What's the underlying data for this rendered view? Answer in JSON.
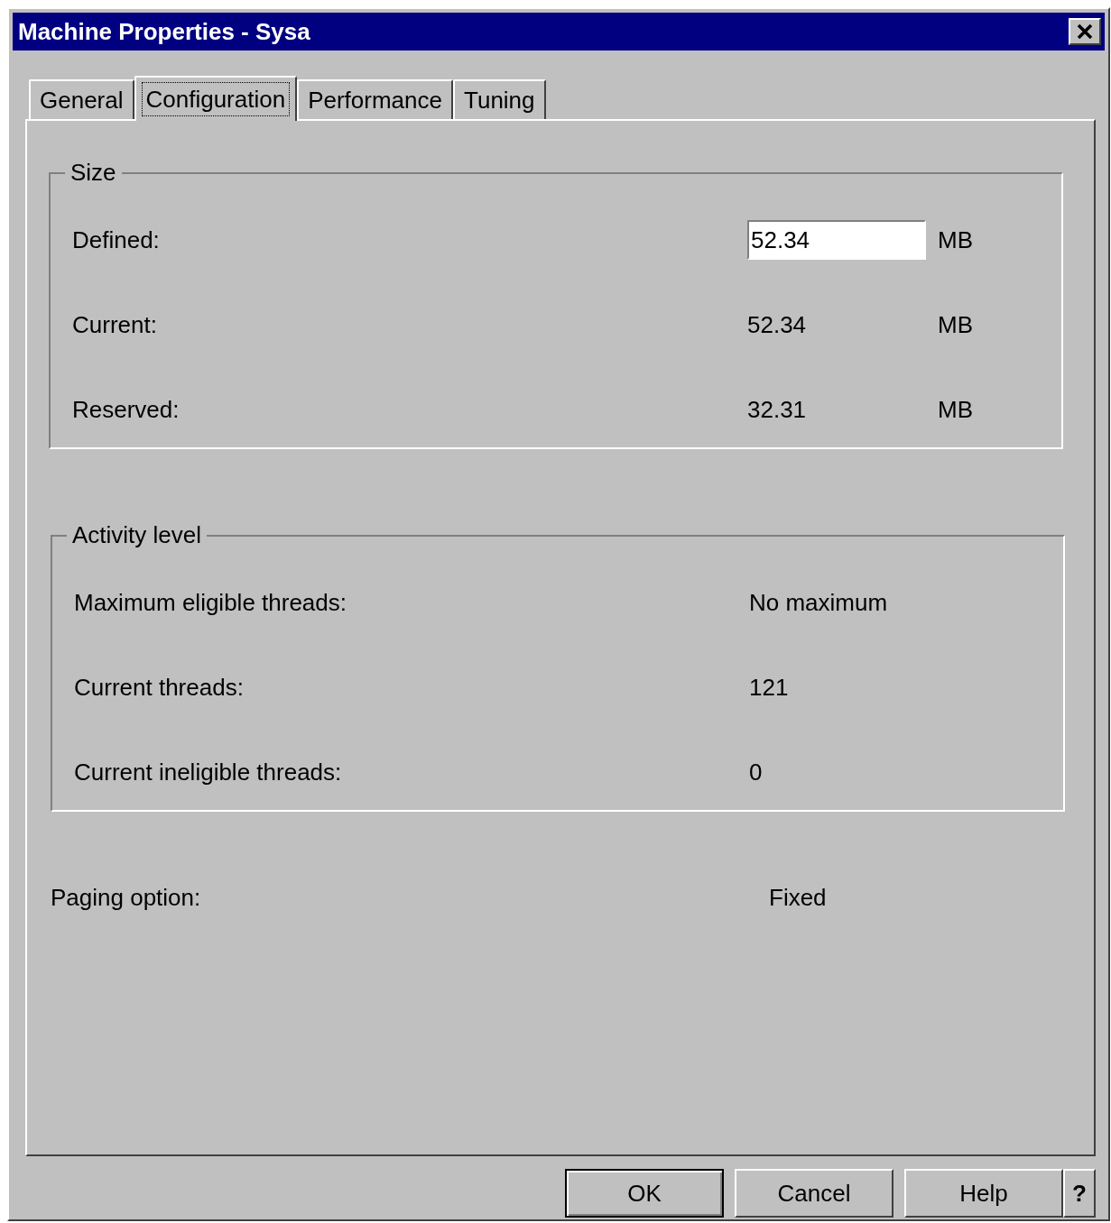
{
  "window": {
    "title": "Machine Properties - Sysa"
  },
  "tabs": [
    {
      "label": "General",
      "selected": false
    },
    {
      "label": "Configuration",
      "selected": true
    },
    {
      "label": "Performance",
      "selected": false
    },
    {
      "label": "Tuning",
      "selected": false
    }
  ],
  "groups": [
    {
      "title": "Size",
      "rows": [
        {
          "label": "Defined:",
          "kind": "field",
          "value": "52.34",
          "unit": "MB"
        },
        {
          "label": "Current:",
          "kind": "text",
          "value": "52.34",
          "unit": "MB"
        },
        {
          "label": "Reserved:",
          "kind": "text",
          "value": "32.31",
          "unit": "MB"
        }
      ]
    },
    {
      "title": "Activity level",
      "rows": [
        {
          "label": "Maximum eligible threads:",
          "kind": "text",
          "value": "No maximum"
        },
        {
          "label": "Current threads:",
          "kind": "text",
          "value": "121"
        },
        {
          "label": "Current ineligible threads:",
          "kind": "text",
          "value": "0"
        }
      ]
    }
  ],
  "paging": {
    "label": "Paging option:",
    "value": "Fixed"
  },
  "buttons": [
    {
      "label": "OK",
      "kind": "default"
    },
    {
      "label": "Cancel",
      "kind": "normal"
    },
    {
      "label": "Help",
      "kind": "normal"
    },
    {
      "label": "?",
      "kind": "context"
    }
  ]
}
